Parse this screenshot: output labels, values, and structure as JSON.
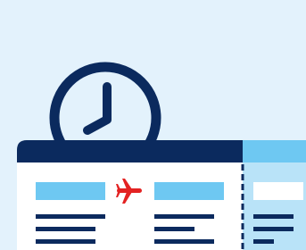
{
  "illustration": {
    "clock_icon": "clock-icon",
    "plane_icon": "airplane-icon",
    "main_ticket_icon": "boarding-pass-icon",
    "stub_icon": "ticket-stub-icon"
  },
  "colors": {
    "background": "#e3f2fc",
    "navy": "#0b2a5e",
    "light_blue": "#6ec8f2",
    "stub_blue": "#b9e3f8",
    "plane_red": "#e32222",
    "white": "#ffffff"
  }
}
